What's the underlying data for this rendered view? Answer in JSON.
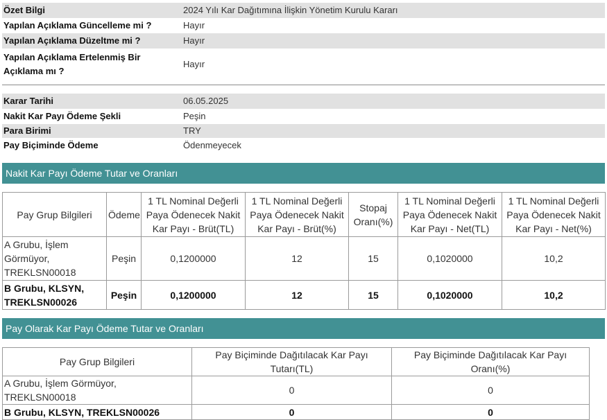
{
  "summary": {
    "label": "Özet Bilgi",
    "value": "2024 Yılı Kar Dağıtımına İlişkin Yönetim Kurulu Kararı",
    "rows": [
      {
        "label": "Yapılan Açıklama Güncelleme mi ?",
        "value": "Hayır"
      },
      {
        "label": "Yapılan Açıklama Düzeltme mi ?",
        "value": "Hayır"
      },
      {
        "label": "Yapılan Açıklama Ertelenmiş Bir Açıklama mı ?",
        "value": "Hayır"
      }
    ]
  },
  "decision": {
    "rows": [
      {
        "label": "Karar Tarihi",
        "value": "06.05.2025"
      },
      {
        "label": "Nakit Kar Payı Ödeme Şekli",
        "value": "Peşin"
      },
      {
        "label": "Para Birimi",
        "value": "TRY"
      },
      {
        "label": "Pay Biçiminde Ödeme",
        "value": "Ödenmeyecek"
      }
    ]
  },
  "cash_section": {
    "title": "Nakit Kar Payı Ödeme Tutar ve Oranları",
    "headers": [
      "Pay Grup Bilgileri",
      "Ödeme",
      "1 TL Nominal Değerli Paya Ödenecek Nakit Kar Payı - Brüt(TL)",
      "1 TL Nominal Değerli Paya Ödenecek Nakit Kar Payı - Brüt(%)",
      "Stopaj Oranı(%)",
      "1 TL Nominal Değerli Paya Ödenecek Nakit Kar Payı - Net(TL)",
      "1 TL Nominal Değerli Paya Ödenecek Nakit Kar Payı - Net(%)"
    ],
    "rows": [
      [
        "A Grubu, İşlem Görmüyor, TREKLSN00018",
        "Peşin",
        "0,1200000",
        "12",
        "15",
        "0,1020000",
        "10,2"
      ],
      [
        "B Grubu, KLSYN, TREKLSN00026",
        "Peşin",
        "0,1200000",
        "12",
        "15",
        "0,1020000",
        "10,2"
      ]
    ]
  },
  "stock_section": {
    "title": "Pay Olarak Kar Payı Ödeme Tutar ve Oranları",
    "headers": [
      "Pay Grup Bilgileri",
      "Pay Biçiminde Dağıtılacak Kar Payı Tutarı(TL)",
      "Pay Biçiminde Dağıtılacak Kar Payı Oranı(%)"
    ],
    "rows": [
      [
        "A Grubu, İşlem Görmüyor, TREKLSN00018",
        "0",
        "0"
      ],
      [
        "B Grubu, KLSYN, TREKLSN00026",
        "0",
        "0"
      ]
    ]
  }
}
